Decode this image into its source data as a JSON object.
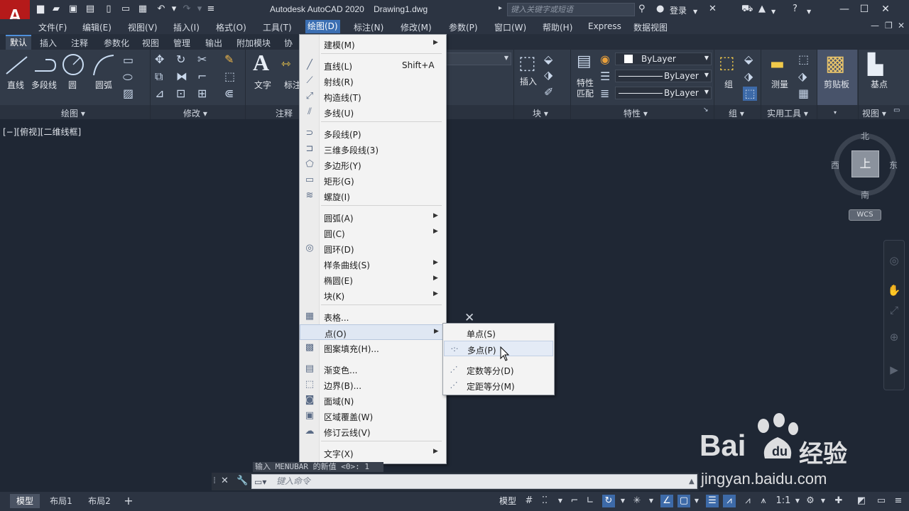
{
  "title_bar": {
    "app_logo": "A",
    "title": "Autodesk AutoCAD 2020    Drawing1.dwg",
    "search_placeholder": "键入关键字或短语",
    "login_label": "登录"
  },
  "menubar": {
    "items": [
      "文件(F)",
      "编辑(E)",
      "视图(V)",
      "插入(I)",
      "格式(O)",
      "工具(T)",
      "绘图(D)",
      "标注(N)",
      "修改(M)",
      "参数(P)",
      "窗口(W)",
      "帮助(H)",
      "Express",
      "数据视图"
    ],
    "active": "绘图(D)"
  },
  "ribbon_tabs": {
    "items": [
      "默认",
      "插入",
      "注释",
      "参数化",
      "视图",
      "管理",
      "输出",
      "附加模块",
      "协"
    ],
    "active": "默认"
  },
  "ribbon": {
    "draw_panel": {
      "title": "绘图 ▾",
      "tools": [
        "直线",
        "多段线",
        "圆",
        "圆弧"
      ]
    },
    "modify_panel": {
      "title": "修改 ▾"
    },
    "annotation_panel": {
      "title": "注释",
      "tools": [
        "文字",
        "标注"
      ]
    },
    "block_panel": {
      "title": "块 ▾",
      "tools": [
        "插入"
      ]
    },
    "properties_panel": {
      "title": "特性 ▾",
      "match": "特性\n匹配",
      "color": "ByLayer",
      "linetype": "ByLayer",
      "lineweight": "ByLayer"
    },
    "group_panel": {
      "title": "组 ▾",
      "tools": [
        "组"
      ]
    },
    "utilities_panel": {
      "title": "实用工具 ▾",
      "tools": [
        "测量"
      ]
    },
    "clipboard_panel": {
      "title": "▾",
      "tools": [
        "剪贴板"
      ]
    },
    "view_panel": {
      "title": "视图 ▾",
      "tools": [
        "基点"
      ]
    }
  },
  "viewport": {
    "label": "[−][俯视][二维线框]",
    "viewcube": {
      "top": "上",
      "north": "北",
      "south": "南",
      "east": "东",
      "west": "西",
      "wcs": "WCS"
    }
  },
  "draw_menu": {
    "items": [
      {
        "label": "建模(M)",
        "submenu": true,
        "icon": ""
      },
      {
        "label": "直线(L)",
        "shortcut": "Shift+A",
        "icon": "line-icon"
      },
      {
        "label": "射线(R)",
        "icon": "ray-icon"
      },
      {
        "label": "构造线(T)",
        "icon": "xline-icon"
      },
      {
        "label": "多线(U)",
        "icon": "mline-icon"
      },
      {
        "label": "多段线(P)",
        "icon": "polyline-icon"
      },
      {
        "label": "三维多段线(3)",
        "icon": "3dpoly-icon"
      },
      {
        "label": "多边形(Y)",
        "icon": "polygon-icon"
      },
      {
        "label": "矩形(G)",
        "icon": "rectangle-icon"
      },
      {
        "label": "螺旋(I)",
        "icon": "helix-icon"
      },
      {
        "label": "圆弧(A)",
        "submenu": true
      },
      {
        "label": "圆(C)",
        "submenu": true
      },
      {
        "label": "圆环(D)",
        "icon": "donut-icon"
      },
      {
        "label": "样条曲线(S)",
        "submenu": true
      },
      {
        "label": "椭圆(E)",
        "submenu": true
      },
      {
        "label": "块(K)",
        "submenu": true
      },
      {
        "label": "表格...",
        "icon": "table-icon"
      },
      {
        "label": "点(O)",
        "submenu": true,
        "highlighted": true
      },
      {
        "label": "图案填充(H)...",
        "icon": "hatch-icon"
      },
      {
        "label": "渐变色...",
        "icon": "gradient-icon"
      },
      {
        "label": "边界(B)...",
        "icon": "boundary-icon"
      },
      {
        "label": "面域(N)",
        "icon": "region-icon"
      },
      {
        "label": "区域覆盖(W)",
        "icon": "wipeout-icon"
      },
      {
        "label": "修订云线(V)",
        "icon": "revcloud-icon"
      },
      {
        "label": "文字(X)",
        "submenu": true
      }
    ]
  },
  "point_submenu": {
    "items": [
      {
        "label": "单点(S)"
      },
      {
        "label": "多点(P)",
        "highlighted": true
      },
      {
        "label": "定数等分(D)"
      },
      {
        "label": "定距等分(M)"
      }
    ]
  },
  "command_line": {
    "history": "输入 MENUBAR 的新值 <0>: 1",
    "placeholder": "键入命令"
  },
  "status_bar": {
    "layouts": [
      "模型",
      "布局1",
      "布局2"
    ],
    "active_layout": "模型",
    "model_label": "模型",
    "scale": "1:1"
  },
  "watermark": {
    "brand": "Bai",
    "product": "经验",
    "url": "jingyan.baidu.com"
  }
}
